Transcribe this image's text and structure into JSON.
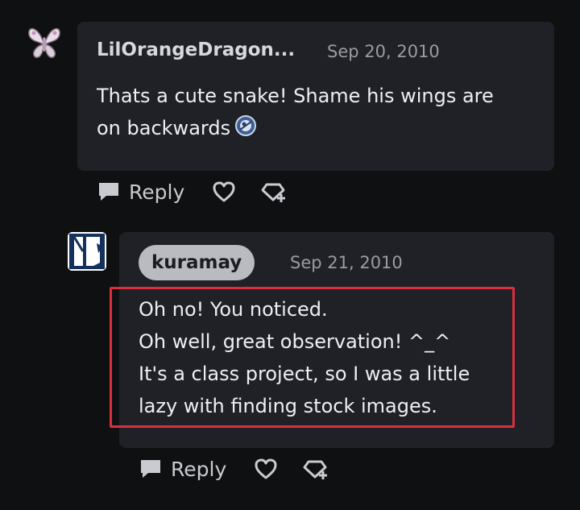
{
  "comments": [
    {
      "username": "LilOrangeDragon...",
      "date": "Sep 20, 2010",
      "lines": [
        "Thats a cute snake! Shame his wings are",
        "on backwards"
      ],
      "reply_label": "Reply"
    },
    {
      "username": "kuramay",
      "date": "Sep 21, 2010",
      "lines": [
        "Oh no! You noticed.",
        "Oh well, great observation! ^_^",
        "It's a class project, so I was a little",
        "lazy with finding stock images."
      ],
      "reply_label": "Reply"
    }
  ],
  "colors": {
    "background": "#0f1012",
    "bubble": "#1f2127",
    "highlight": "#d92f3e",
    "username_pill": "#b9bbc1"
  },
  "icons": [
    "butterfly-avatar",
    "deviantart-avatar",
    "speech-bubble-icon",
    "heart-icon",
    "add-favorite-icon",
    "emoticon"
  ]
}
